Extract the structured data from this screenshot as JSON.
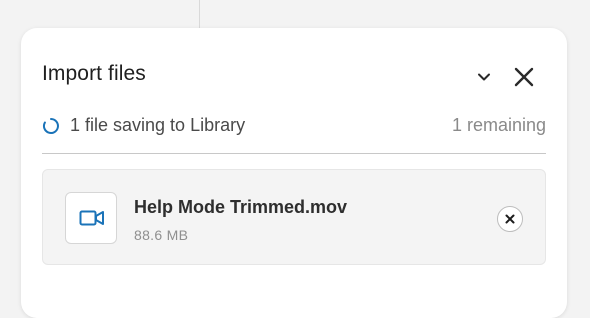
{
  "dialog": {
    "title": "Import files",
    "collapse_icon": "chevron-down-icon",
    "close_icon": "close-icon"
  },
  "status": {
    "icon": "spinner-icon",
    "text": "1 file saving to Library",
    "remaining": "1 remaining"
  },
  "files": [
    {
      "icon": "video-camera-icon",
      "name": "Help Mode Trimmed.mov",
      "size": "88.6 MB",
      "remove_icon": "close-small-icon"
    }
  ],
  "colors": {
    "accent": "#1a73b8",
    "title_text": "#202020",
    "secondary_text": "#8a8a8a"
  }
}
